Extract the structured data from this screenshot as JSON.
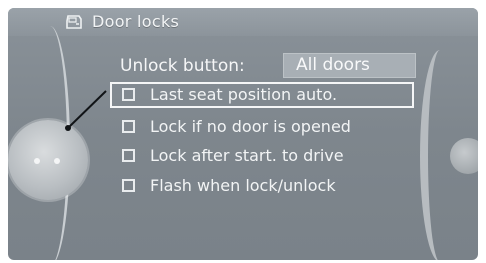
{
  "header": {
    "title": "Door locks",
    "icon": "car-door-icon"
  },
  "unlock_setting": {
    "label": "Unlock button:",
    "value": "All doors"
  },
  "options": [
    {
      "label": "Last seat position auto.",
      "selected": true
    },
    {
      "label": "Lock if no door is opened",
      "selected": false
    },
    {
      "label": "Lock after start. to drive",
      "selected": false
    },
    {
      "label": "Flash when lock/unlock",
      "selected": false
    }
  ],
  "colors": {
    "screen_bg": "#7e868d",
    "text": "#f2f4f5",
    "value_box": "#a8afb5"
  }
}
